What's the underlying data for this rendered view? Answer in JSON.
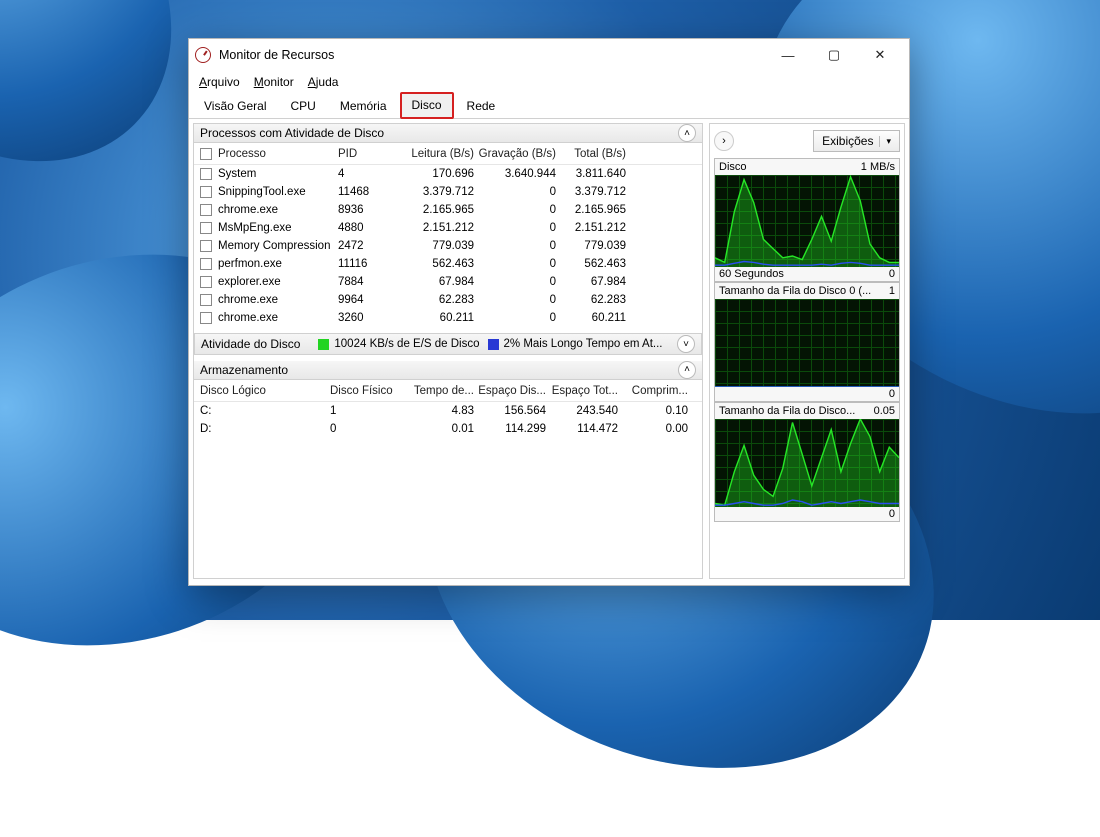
{
  "window": {
    "title": "Monitor de Recursos",
    "menu": {
      "file": "Arquivo",
      "monitor": "Monitor",
      "help": "Ajuda"
    },
    "tabs": {
      "overview": "Visão Geral",
      "cpu": "CPU",
      "memory": "Memória",
      "disk": "Disco",
      "network": "Rede"
    }
  },
  "processes_panel": {
    "title": "Processos com Atividade de Disco",
    "cols": {
      "process": "Processo",
      "pid": "PID",
      "read": "Leitura (B/s)",
      "write": "Gravação (B/s)",
      "total": "Total (B/s)"
    },
    "rows": [
      {
        "name": "System",
        "pid": "4",
        "read": "170.696",
        "write": "3.640.944",
        "total": "3.811.640"
      },
      {
        "name": "SnippingTool.exe",
        "pid": "11468",
        "read": "3.379.712",
        "write": "0",
        "total": "3.379.712"
      },
      {
        "name": "chrome.exe",
        "pid": "8936",
        "read": "2.165.965",
        "write": "0",
        "total": "2.165.965"
      },
      {
        "name": "MsMpEng.exe",
        "pid": "4880",
        "read": "2.151.212",
        "write": "0",
        "total": "2.151.212"
      },
      {
        "name": "Memory Compression",
        "pid": "2472",
        "read": "779.039",
        "write": "0",
        "total": "779.039"
      },
      {
        "name": "perfmon.exe",
        "pid": "11116",
        "read": "562.463",
        "write": "0",
        "total": "562.463"
      },
      {
        "name": "explorer.exe",
        "pid": "7884",
        "read": "67.984",
        "write": "0",
        "total": "67.984"
      },
      {
        "name": "chrome.exe",
        "pid": "9964",
        "read": "62.283",
        "write": "0",
        "total": "62.283"
      },
      {
        "name": "chrome.exe",
        "pid": "3260",
        "read": "60.211",
        "write": "0",
        "total": "60.211"
      }
    ]
  },
  "activity_panel": {
    "title": "Atividade do Disco",
    "metric1_color": "#22d422",
    "metric1": "10024 KB/s de E/S de Disco",
    "metric2_color": "#2838d4",
    "metric2": "2% Mais Longo Tempo em At..."
  },
  "storage_panel": {
    "title": "Armazenamento",
    "cols": {
      "logical": "Disco Lógico",
      "physical": "Disco Físico",
      "time": "Tempo de...",
      "avail": "Espaço Dis...",
      "total": "Espaço Tot...",
      "queue": "Comprim..."
    },
    "rows": [
      {
        "logical": "C:",
        "physical": "1",
        "time": "4.83",
        "avail": "156.564",
        "total": "243.540",
        "queue": "0.10"
      },
      {
        "logical": "D:",
        "physical": "0",
        "time": "0.01",
        "avail": "114.299",
        "total": "114.472",
        "queue": "0.00"
      }
    ]
  },
  "right": {
    "views_label": "Exibições",
    "charts": [
      {
        "title": "Disco",
        "scale": "1 MB/s",
        "footer_left": "60 Segundos",
        "footer_right": "0"
      },
      {
        "title": "Tamanho da Fila do Disco 0 (...",
        "scale": "1",
        "footer_left": "",
        "footer_right": "0"
      },
      {
        "title": "Tamanho da Fila do Disco...",
        "scale": "0.05",
        "footer_left": "",
        "footer_right": "0"
      }
    ]
  },
  "chart_data": [
    {
      "type": "area",
      "title": "Disco",
      "ylabel": "MB/s",
      "ylim": [
        0,
        1
      ],
      "x_seconds": 60,
      "series": [
        {
          "name": "green",
          "color": "#26e626",
          "values": [
            0.1,
            0.05,
            0.6,
            0.95,
            0.7,
            0.3,
            0.2,
            0.1,
            0.12,
            0.08,
            0.3,
            0.55,
            0.28,
            0.65,
            0.98,
            0.72,
            0.25,
            0.1,
            0.05,
            0.05
          ]
        },
        {
          "name": "blue",
          "color": "#2a4ef0",
          "values": [
            0.02,
            0.02,
            0.04,
            0.06,
            0.05,
            0.03,
            0.02,
            0.02,
            0.02,
            0.02,
            0.02,
            0.03,
            0.02,
            0.04,
            0.05,
            0.04,
            0.02,
            0.02,
            0.02,
            0.02
          ]
        }
      ]
    },
    {
      "type": "area",
      "title": "Tamanho da Fila do Disco 0",
      "ylim": [
        0,
        1
      ],
      "x_seconds": 60,
      "series": [
        {
          "name": "green",
          "color": "#26e626",
          "values": [
            0,
            0,
            0,
            0,
            0,
            0,
            0,
            0,
            0,
            0,
            0,
            0,
            0,
            0,
            0,
            0,
            0,
            0,
            0,
            0
          ]
        },
        {
          "name": "blue",
          "color": "#2a4ef0",
          "values": [
            0,
            0,
            0,
            0,
            0,
            0,
            0,
            0,
            0,
            0,
            0,
            0,
            0,
            0,
            0,
            0,
            0,
            0,
            0,
            0
          ]
        }
      ]
    },
    {
      "type": "area",
      "title": "Tamanho da Fila do Disco 1",
      "ylim": [
        0,
        0.05
      ],
      "x_seconds": 60,
      "series": [
        {
          "name": "green",
          "color": "#26e626",
          "values": [
            0.002,
            0.001,
            0.02,
            0.035,
            0.018,
            0.01,
            0.006,
            0.022,
            0.048,
            0.03,
            0.012,
            0.028,
            0.044,
            0.02,
            0.036,
            0.05,
            0.04,
            0.02,
            0.034,
            0.028
          ]
        },
        {
          "name": "blue",
          "color": "#2a4ef0",
          "values": [
            0.001,
            0.001,
            0.002,
            0.003,
            0.002,
            0.001,
            0.001,
            0.002,
            0.004,
            0.003,
            0.001,
            0.002,
            0.003,
            0.002,
            0.003,
            0.004,
            0.003,
            0.002,
            0.002,
            0.002
          ]
        }
      ]
    }
  ]
}
